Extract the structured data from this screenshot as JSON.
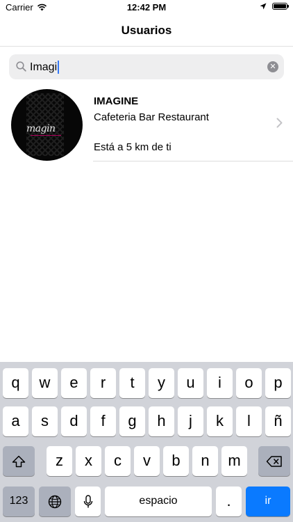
{
  "status_bar": {
    "carrier": "Carrier",
    "time": "12:42 PM",
    "battery_level": 1.0
  },
  "nav": {
    "title": "Usuarios"
  },
  "search": {
    "value": "Imagi",
    "icon": "search-icon",
    "clear_icon": "clear-icon"
  },
  "results": [
    {
      "name": "IMAGINE",
      "category": "Cafeteria Bar Restaurant",
      "distance": "Está a 5 km de ti"
    }
  ],
  "keyboard": {
    "row1": [
      "q",
      "w",
      "e",
      "r",
      "t",
      "y",
      "u",
      "i",
      "o",
      "p"
    ],
    "row2": [
      "a",
      "s",
      "d",
      "f",
      "g",
      "h",
      "j",
      "k",
      "l",
      "ñ"
    ],
    "row3": [
      "z",
      "x",
      "c",
      "v",
      "b",
      "n",
      "m"
    ],
    "numbers_label": "123",
    "space_label": "espacio",
    "period_label": ".",
    "go_label": "ir"
  },
  "colors": {
    "accent": "#0a7aff",
    "caret": "#3478f6",
    "keyboard_bg": "#d1d3d9"
  }
}
